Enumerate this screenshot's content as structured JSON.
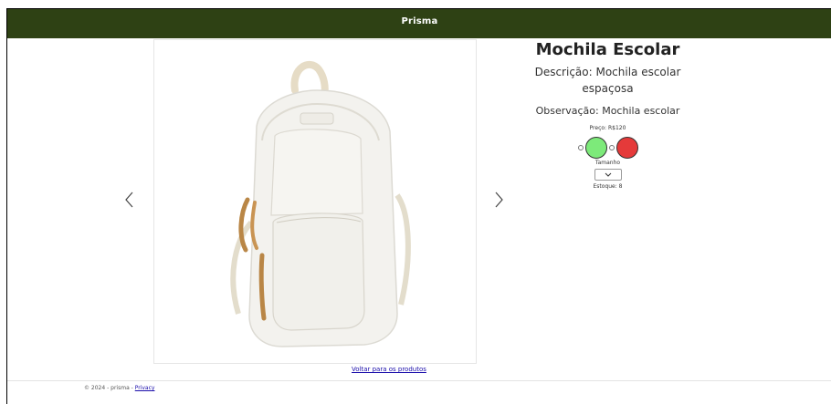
{
  "navbar": {
    "brand": "Prisma"
  },
  "product": {
    "title": "Mochila Escolar",
    "description": "Descrição: Mochila escolar espaçosa",
    "observation": "Observação: Mochila escolar",
    "price": "Preço: R$120",
    "colors": [
      {
        "name": "green",
        "hex": "#7dea7a"
      },
      {
        "name": "red",
        "hex": "#e53a3a"
      }
    ],
    "size_label": "Tamanho",
    "size_selected": "",
    "stock": "Estoque: 8"
  },
  "carousel": {
    "image_icon": "backpack-image",
    "prev_icon": "chevron-left-icon",
    "next_icon": "chevron-right-icon"
  },
  "back_link": "Voltar para os produtos",
  "footer": {
    "copyright": "© 2024 - prisma - ",
    "privacy": "Privacy"
  },
  "colors": {
    "navbar_bg": "#2e4114",
    "link": "#1a0dab"
  }
}
